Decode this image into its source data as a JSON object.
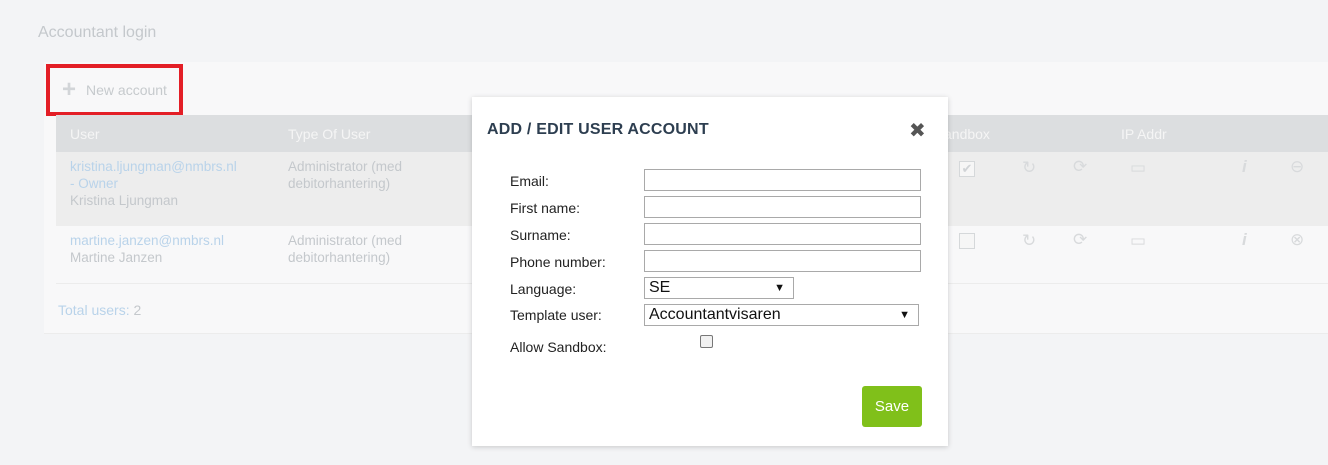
{
  "page": {
    "title": "Accountant login"
  },
  "toolbar": {
    "new_account_label": "New account",
    "plus_glyph": "+"
  },
  "table": {
    "columns": [
      "User",
      "Type Of User",
      "andbox",
      "IP Addr"
    ],
    "rows": [
      {
        "email": "kristina.ljungman@nmbrs.nl",
        "owner_tag": "- Owner",
        "name": "Kristina Ljungman",
        "type_line1": "Administrator (med",
        "type_line2": "debitorhantering)",
        "sandbox_checked": true
      },
      {
        "email": "martine.janzen@nmbrs.nl",
        "owner_tag": "",
        "name": "Martine Janzen",
        "type_line1": "Administrator (med",
        "type_line2": "debitorhantering)",
        "sandbox_checked": false
      }
    ],
    "total_label": "Total users:",
    "total_value": "2"
  },
  "modal": {
    "title": "ADD / EDIT USER ACCOUNT",
    "close_glyph": "✖",
    "fields": {
      "email_label": "Email:",
      "email_value": "",
      "first_name_label": "First name:",
      "first_name_value": "",
      "surname_label": "Surname:",
      "surname_value": "",
      "phone_label": "Phone number:",
      "phone_value": "",
      "language_label": "Language:",
      "language_value": "SE",
      "template_label": "Template user:",
      "template_value": "Accountantvisaren",
      "sandbox_label": "Allow Sandbox:",
      "sandbox_checked": false
    },
    "save_label": "Save"
  },
  "colors": {
    "highlight_border": "#e31e26",
    "save_button": "#80c01a",
    "modal_title": "#2d3e50",
    "link_faded": "#b9d3ea"
  }
}
